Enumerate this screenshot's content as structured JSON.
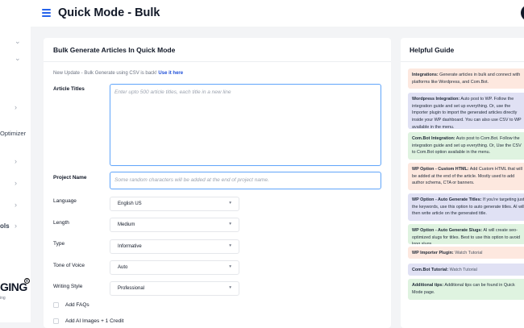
{
  "header": {
    "title": "Quick Mode - Bulk"
  },
  "sidebar": {
    "partial_labels": [
      "Optimizer",
      "ols"
    ],
    "logo_text": "GING",
    "logo_sub": "ing"
  },
  "main": {
    "title": "Bulk Generate Articles In Quick Mode",
    "notice_text": "New Update - Bulk Generate using CSV is back! ",
    "notice_link": "Use it here",
    "article_titles": {
      "label": "Article Titles",
      "placeholder": "Enter upto 500 article titles, each title in a new line"
    },
    "project_name": {
      "label": "Project Name",
      "placeholder": "Some random characters will be added at the end of project name."
    },
    "selects": [
      {
        "label": "Language",
        "value": "English US"
      },
      {
        "label": "Length",
        "value": "Medium"
      },
      {
        "label": "Type",
        "value": "Informative"
      },
      {
        "label": "Tone of Voice",
        "value": "Auto"
      },
      {
        "label": "Writing Style",
        "value": "Professional"
      }
    ],
    "checkboxes": [
      {
        "label": "Add FAQs"
      },
      {
        "label": "Add AI Images + 1 Credit"
      }
    ]
  },
  "guide": {
    "title": "Helpful Guide",
    "tips": [
      {
        "title": "Integrations:",
        "text": " Generate articles in bulk and connect with platforms like Wordpress, and Com.Bot.",
        "color": "orange"
      },
      {
        "title": "Wordpress Integration:",
        "text": " Auto post to WP. Follow the integration guide and set up everything. Or, use the Importer plugin to import the generated articles directly inside your WP dashboard. You can also use CSV to WP available in the menu.",
        "color": "purple"
      },
      {
        "title": "Com.Bot Integration:",
        "text": " Auto post to Com.Bot. Follow the integration guide and set up everything. Or, Use the CSV to Com.Bot option available in the menu.",
        "color": "green"
      },
      {
        "title": "WP Option - Custom HTML:",
        "text": " Add Custom HTML that will be added at the end of the article. Mostly used to add author schema, CTA or banners.",
        "color": "orange"
      },
      {
        "title": "WP Option - Auto Generate Titles:",
        "text": " If you're targeting just the keywords, use this option to auto generate titles. AI will then write article on the generated title.",
        "color": "purple"
      },
      {
        "title": "WP Option - Auto Generate Slugs:",
        "text": " AI will create seo-optimized slugs for titles. Best to use this option to avoid long slugs.",
        "color": "green"
      },
      {
        "title": "WP Importer Plugin:",
        "text": " Watch Tutorial",
        "color": "orange",
        "link": true
      },
      {
        "title": "Com.Bot Tutorial:",
        "text": " Watch Tutorial",
        "color": "purple",
        "link": true
      },
      {
        "title": "Additional tips:",
        "text": " Additional tips can be found in Quick Mode page.",
        "color": "green"
      }
    ]
  },
  "colors": {
    "accent": "#2563eb",
    "input_border": "#60a5fa",
    "tip_orange": "#fde8df",
    "tip_purple": "#e0e1f4",
    "tip_green": "#dff3e0"
  }
}
